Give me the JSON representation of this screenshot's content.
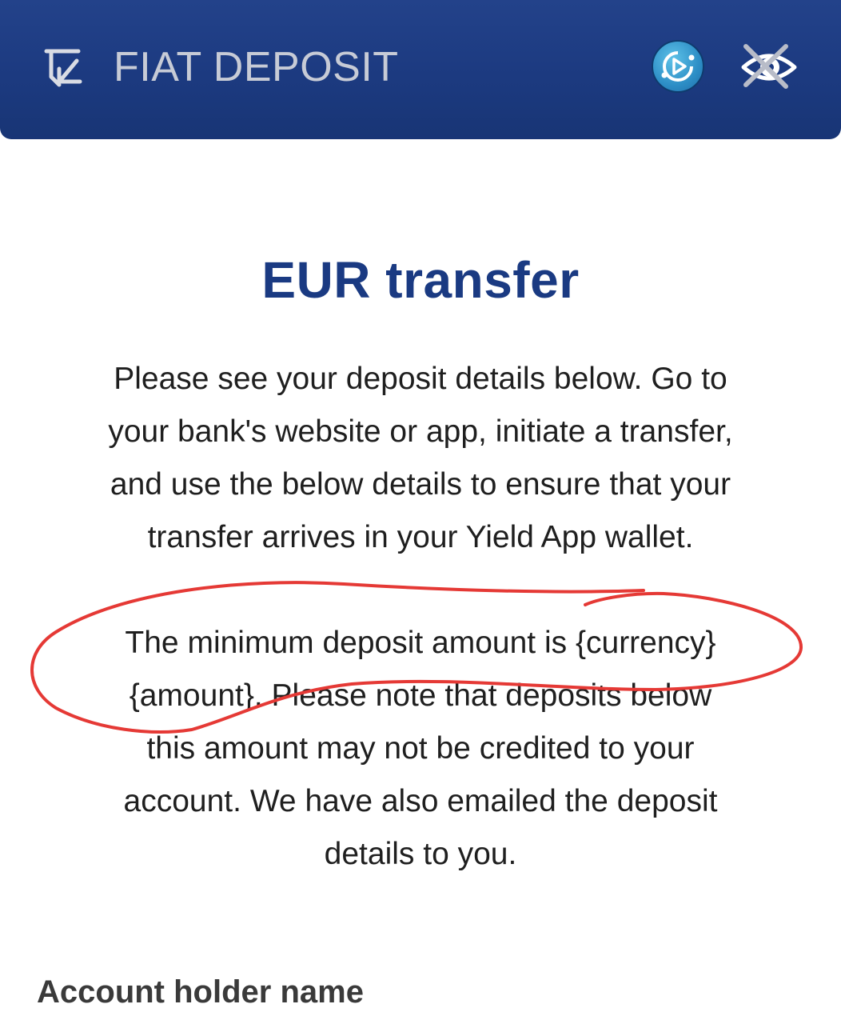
{
  "header": {
    "title": "FIAT DEPOSIT",
    "deposit_icon": "deposit-arrow-icon",
    "media_button_icon": "play-circle-icon",
    "visibility_icon": "eye-off-icon",
    "background_color": "#1c3a80"
  },
  "content": {
    "title": "EUR transfer",
    "intro_lines": [
      "Please see your deposit details below. Go to",
      "your bank's website or app, initiate a transfer,",
      "and use the below details to ensure that your",
      "transfer arrives in your Yield App wallet."
    ],
    "minimum_lines": [
      "The minimum deposit amount is {currency}",
      "{amount}. Please note that deposits below",
      "this amount may not be credited to your",
      "account. We have also emailed the deposit",
      "details to you."
    ],
    "account_holder_label": "Account holder name"
  },
  "annotation": {
    "type": "red-freehand-circle",
    "color": "#e53935"
  }
}
